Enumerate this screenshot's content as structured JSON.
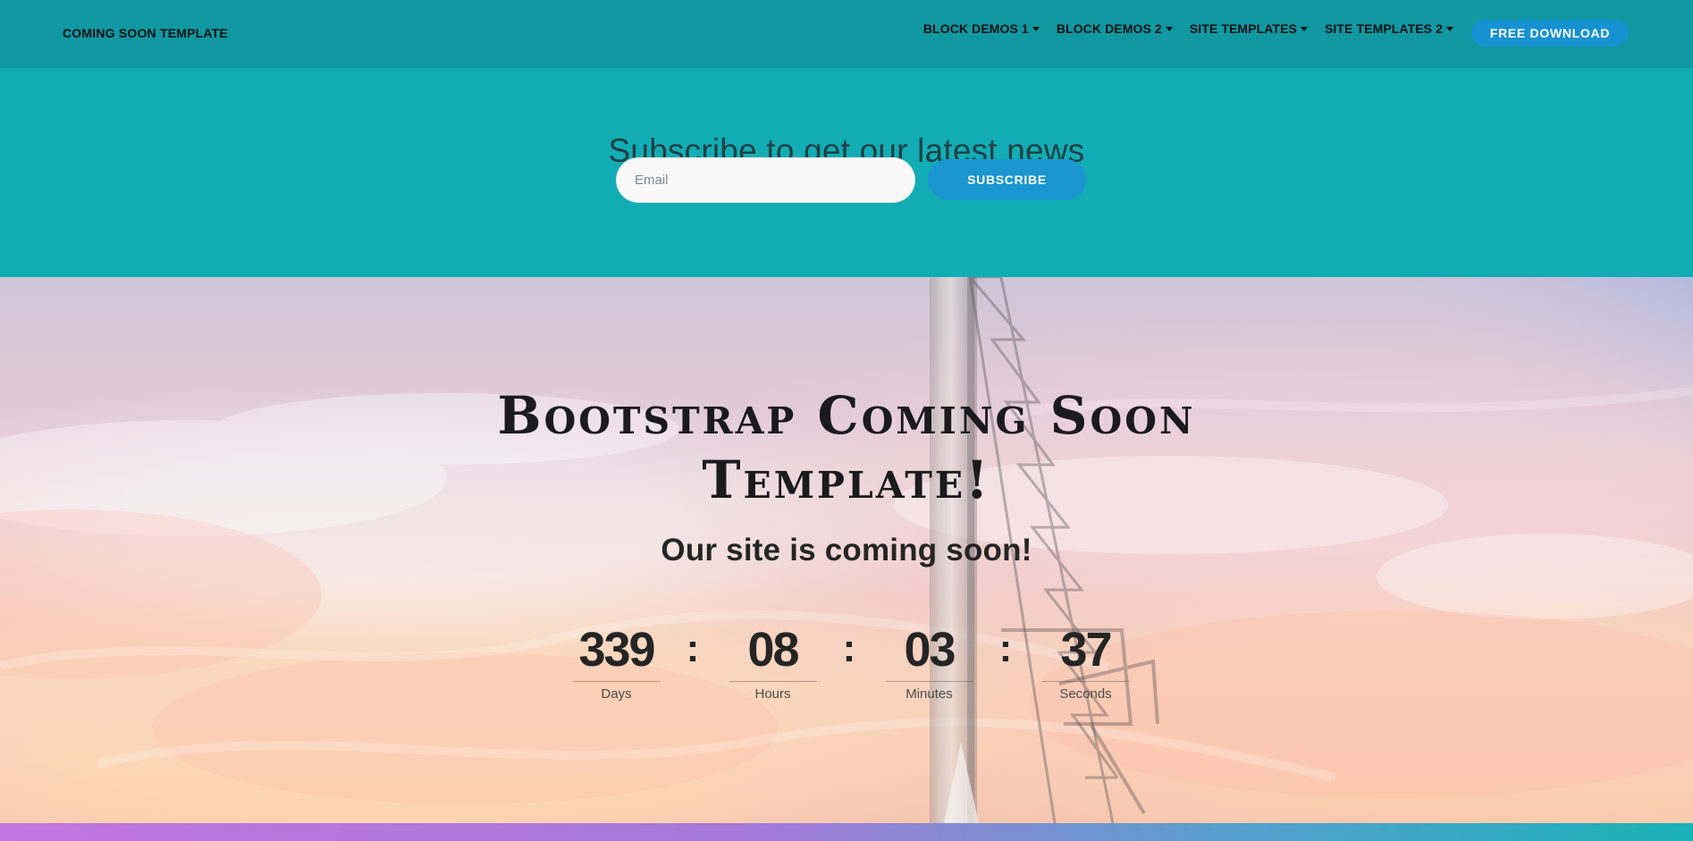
{
  "header": {
    "brand": "COMING SOON TEMPLATE",
    "nav": [
      {
        "label": "BLOCK DEMOS 1",
        "icon": "chevron-down-icon"
      },
      {
        "label": "BLOCK DEMOS 2",
        "icon": "chevron-down-icon"
      },
      {
        "label": "SITE TEMPLATES",
        "icon": "chevron-down-icon"
      },
      {
        "label": "SITE TEMPLATES 2",
        "icon": "chevron-down-icon"
      }
    ],
    "download_label": "FREE DOWNLOAD"
  },
  "subscribe": {
    "title": "Subscribe to get our latest news",
    "email_placeholder": "Email",
    "button_label": "SUBSCRIBE"
  },
  "hero": {
    "title": "Bootstrap Coming Soon Template!",
    "subtitle": "Our site is coming soon!",
    "countdown": {
      "separator": ":",
      "items": [
        {
          "value": "339",
          "label": "Days"
        },
        {
          "value": "08",
          "label": "Hours"
        },
        {
          "value": "03",
          "label": "Minutes"
        },
        {
          "value": "37",
          "label": "Seconds"
        }
      ]
    }
  },
  "colors": {
    "header_background": "#1198a1",
    "subscribe_background": "#12adb4",
    "button_blue": "#1792d1",
    "bottom_gradient_start": "#c276df",
    "bottom_gradient_end": "#19b1b7"
  }
}
